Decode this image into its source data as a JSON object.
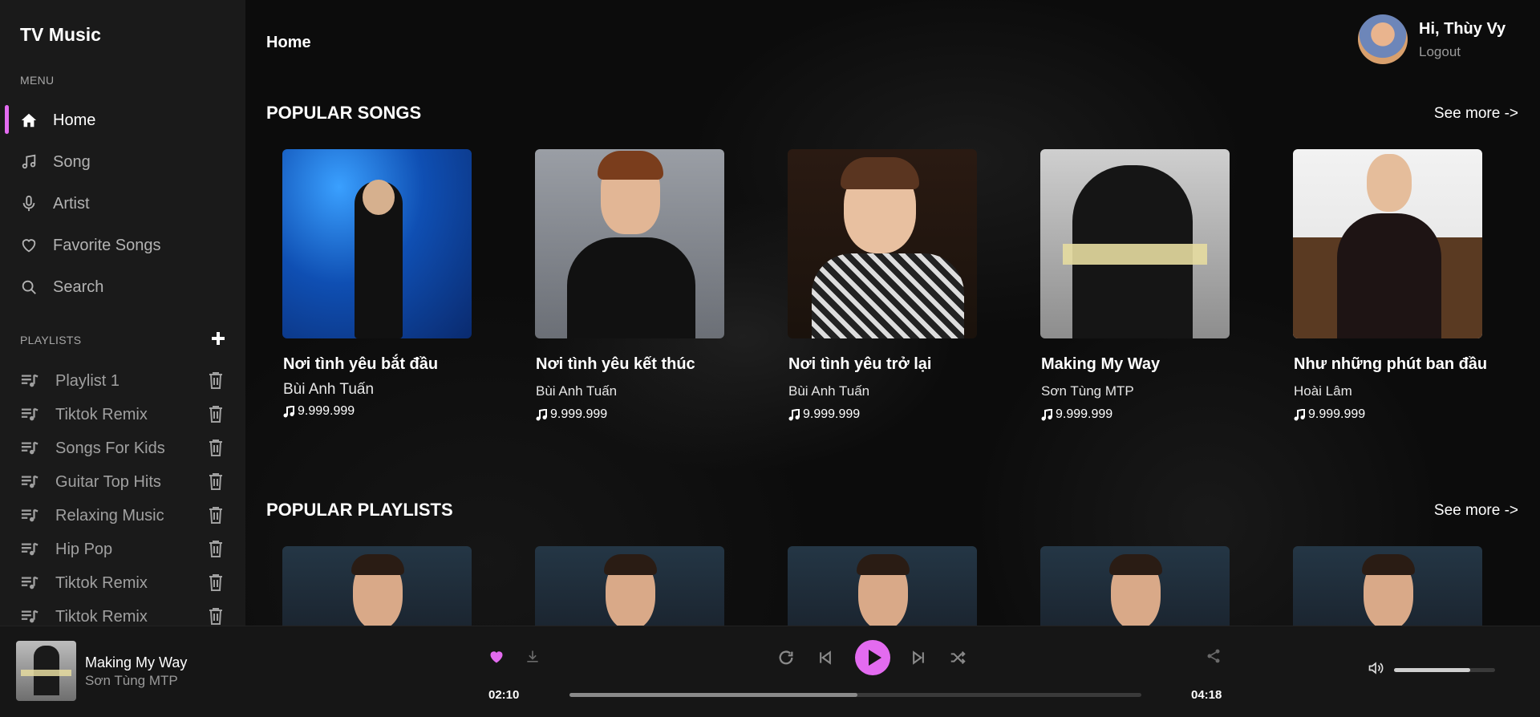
{
  "app": {
    "name": "TV Music"
  },
  "sidebar": {
    "menu_label": "MENU",
    "menu": [
      {
        "label": "Home",
        "icon": "home-icon",
        "active": true
      },
      {
        "label": "Song",
        "icon": "music-note-icon"
      },
      {
        "label": "Artist",
        "icon": "microphone-icon"
      },
      {
        "label": "Favorite Songs",
        "icon": "heart-icon"
      },
      {
        "label": "Search",
        "icon": "search-icon"
      }
    ],
    "playlists_label": "PLAYLISTS",
    "playlists": [
      {
        "label": "Playlist 1"
      },
      {
        "label": "Tiktok Remix"
      },
      {
        "label": "Songs For Kids"
      },
      {
        "label": "Guitar Top Hits"
      },
      {
        "label": "Relaxing Music"
      },
      {
        "label": "Hip Pop"
      },
      {
        "label": "Tiktok Remix"
      },
      {
        "label": "Tiktok Remix"
      }
    ]
  },
  "header": {
    "title": "Home",
    "greeting": "Hi, Thùy Vy",
    "logout": "Logout"
  },
  "popular_songs": {
    "title": "POPULAR SONGS",
    "see_more": "See more ->",
    "items": [
      {
        "title": "Nơi tình yêu bắt đầu",
        "artist": "Bùi Anh Tuấn",
        "plays": "9.999.999"
      },
      {
        "title": "Nơi tình yêu kết thúc",
        "artist": "Bùi Anh Tuấn",
        "plays": "9.999.999"
      },
      {
        "title": "Nơi tình yêu trở lại",
        "artist": "Bùi Anh Tuấn",
        "plays": "9.999.999"
      },
      {
        "title": "Making My Way",
        "artist": "Sơn Tùng MTP",
        "plays": "9.999.999"
      },
      {
        "title": "Như những phút ban đầu",
        "artist": "Hoài Lâm",
        "plays": "9.999.999"
      }
    ]
  },
  "popular_playlists": {
    "title": "POPULAR PLAYLISTS",
    "see_more": "See more ->",
    "count": 5
  },
  "player": {
    "title": "Making My Way",
    "artist": "Sơn Tùng MTP",
    "current_time": "02:10",
    "total_time": "04:18",
    "progress": 0.503,
    "volume": 0.75,
    "favorite": true,
    "accent": "#e36bf0"
  }
}
